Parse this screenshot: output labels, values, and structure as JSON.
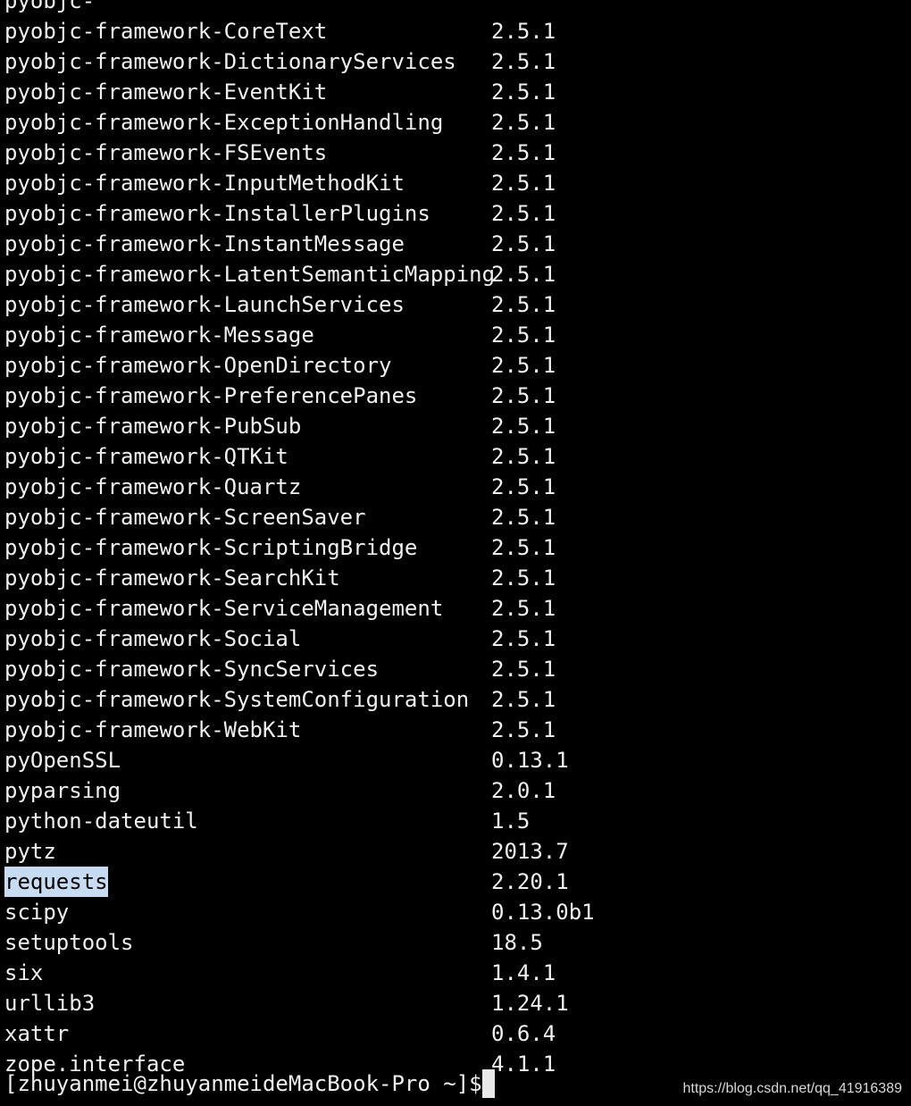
{
  "terminal": {
    "colors": {
      "background": "#000000",
      "foreground": "#f0f0f0",
      "selection": "#c7dbf2"
    },
    "packages": [
      {
        "name": "pyobjc-",
        "version": ""
      },
      {
        "name": "pyobjc-framework-CoreText",
        "version": "2.5.1"
      },
      {
        "name": "pyobjc-framework-DictionaryServices",
        "version": "2.5.1"
      },
      {
        "name": "pyobjc-framework-EventKit",
        "version": "2.5.1"
      },
      {
        "name": "pyobjc-framework-ExceptionHandling",
        "version": "2.5.1"
      },
      {
        "name": "pyobjc-framework-FSEvents",
        "version": "2.5.1"
      },
      {
        "name": "pyobjc-framework-InputMethodKit",
        "version": "2.5.1"
      },
      {
        "name": "pyobjc-framework-InstallerPlugins",
        "version": "2.5.1"
      },
      {
        "name": "pyobjc-framework-InstantMessage",
        "version": "2.5.1"
      },
      {
        "name": "pyobjc-framework-LatentSemanticMapping",
        "version": "2.5.1"
      },
      {
        "name": "pyobjc-framework-LaunchServices",
        "version": "2.5.1"
      },
      {
        "name": "pyobjc-framework-Message",
        "version": "2.5.1"
      },
      {
        "name": "pyobjc-framework-OpenDirectory",
        "version": "2.5.1"
      },
      {
        "name": "pyobjc-framework-PreferencePanes",
        "version": "2.5.1"
      },
      {
        "name": "pyobjc-framework-PubSub",
        "version": "2.5.1"
      },
      {
        "name": "pyobjc-framework-QTKit",
        "version": "2.5.1"
      },
      {
        "name": "pyobjc-framework-Quartz",
        "version": "2.5.1"
      },
      {
        "name": "pyobjc-framework-ScreenSaver",
        "version": "2.5.1"
      },
      {
        "name": "pyobjc-framework-ScriptingBridge",
        "version": "2.5.1"
      },
      {
        "name": "pyobjc-framework-SearchKit",
        "version": "2.5.1"
      },
      {
        "name": "pyobjc-framework-ServiceManagement",
        "version": "2.5.1"
      },
      {
        "name": "pyobjc-framework-Social",
        "version": "2.5.1"
      },
      {
        "name": "pyobjc-framework-SyncServices",
        "version": "2.5.1"
      },
      {
        "name": "pyobjc-framework-SystemConfiguration",
        "version": "2.5.1"
      },
      {
        "name": "pyobjc-framework-WebKit",
        "version": "2.5.1"
      },
      {
        "name": "pyOpenSSL",
        "version": "0.13.1"
      },
      {
        "name": "pyparsing",
        "version": "2.0.1"
      },
      {
        "name": "python-dateutil",
        "version": "1.5"
      },
      {
        "name": "pytz",
        "version": "2013.7"
      },
      {
        "name": "requests",
        "version": "2.20.1",
        "selected": true
      },
      {
        "name": "scipy",
        "version": "0.13.0b1"
      },
      {
        "name": "setuptools",
        "version": "18.5"
      },
      {
        "name": "six",
        "version": "1.4.1"
      },
      {
        "name": "urllib3",
        "version": "1.24.1"
      },
      {
        "name": "xattr",
        "version": "0.6.4"
      },
      {
        "name": "zope.interface",
        "version": "4.1.1"
      }
    ],
    "prompt": "[zhuyanmei@zhuyanmeideMacBook-Pro ~]$"
  },
  "watermark": {
    "text": "https://blog.csdn.net/qq_41916389"
  }
}
